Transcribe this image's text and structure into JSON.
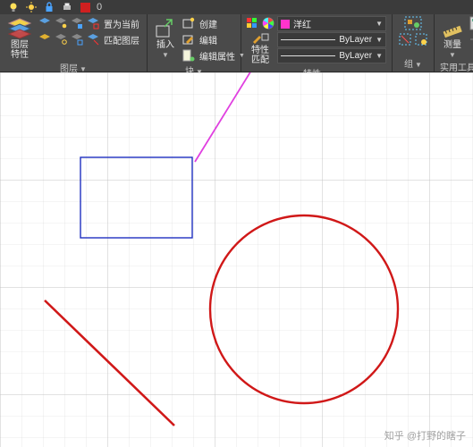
{
  "topstrip": {
    "zero": "0"
  },
  "panels": {
    "layers": {
      "title": "图层",
      "big_label": "图层\n特性",
      "set_current": "置为当前",
      "match_layer": "匹配图层"
    },
    "block": {
      "title": "块",
      "insert": "插入",
      "create": "创建",
      "edit": "编辑",
      "edit_attr": "编辑属性"
    },
    "properties": {
      "title": "特性",
      "big_label": "特性\n匹配",
      "color": {
        "swatch": "#ff33cc",
        "name": "洋红"
      },
      "layer": {
        "name": "ByLayer"
      },
      "ltype": {
        "name": "ByLayer"
      }
    },
    "group": {
      "title": "组"
    },
    "util": {
      "title": "实用工具",
      "measure": "测量"
    }
  },
  "watermark": "知乎 @打野的瞎子"
}
